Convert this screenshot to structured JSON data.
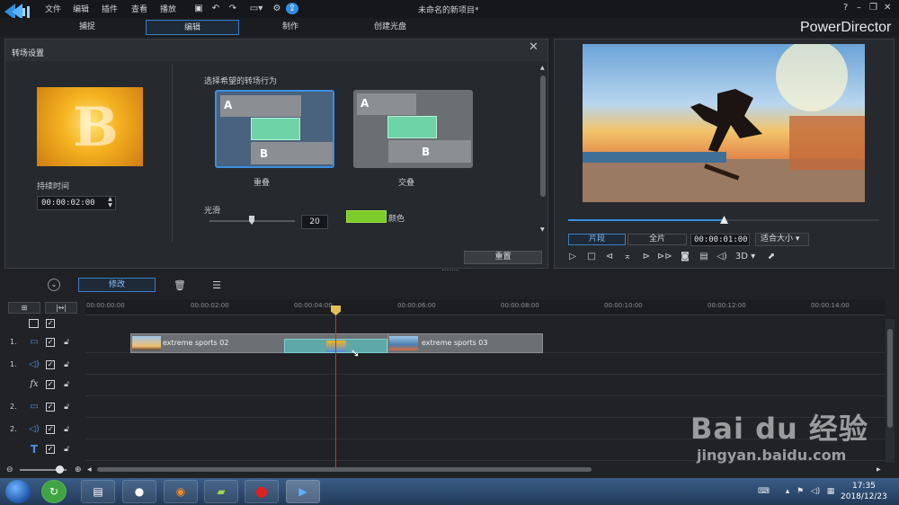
{
  "app": {
    "title": "未命名的新项目*",
    "brand": "PowerDirector"
  },
  "menu": [
    "文件",
    "编辑",
    "插件",
    "查看",
    "播放"
  ],
  "modes": [
    "捕捉",
    "编辑",
    "制作",
    "创建光盘"
  ],
  "transition_panel": {
    "title": "转场设置",
    "duration_label": "持续时间",
    "duration": "00:00:02:00",
    "behavior_label": "选择希望的转场行为",
    "options": [
      {
        "label": "重叠",
        "a": "A",
        "b": "B"
      },
      {
        "label": "交叠",
        "a": "A",
        "b": "B"
      }
    ],
    "smooth_label": "光滑",
    "smooth_value": "20",
    "color_label": "颜色",
    "color_value": "#7ccc2a",
    "reset": "重置",
    "thumb_letter": "B"
  },
  "preview": {
    "clip_btn": "片段",
    "full_btn": "全片",
    "timecode": "00:00:01:00",
    "fit": "适合大小",
    "threed": "3D",
    "progress": 0.5
  },
  "toolbar": {
    "modify": "修改"
  },
  "timeline": {
    "ticks": [
      "00:00:00:00",
      "00:00:02:00",
      "00:00:04:00",
      "00:00:06:00",
      "00:00:08:00",
      "00:00:10:00",
      "00:00:12:00",
      "00:00:14:00"
    ],
    "tracks": [
      {
        "num": "1.",
        "icon": "video"
      },
      {
        "num": "1.",
        "icon": "audio"
      },
      {
        "num": "",
        "icon": "fx"
      },
      {
        "num": "2.",
        "icon": "video"
      },
      {
        "num": "2.",
        "icon": "audio"
      },
      {
        "num": "",
        "icon": "text"
      }
    ],
    "clips": [
      {
        "label": "extreme sports 02"
      },
      {
        "label": "extreme sports 03"
      }
    ]
  },
  "taskbar": {
    "time": "17:35",
    "date": "2018/12/23"
  },
  "watermark": {
    "brand": "Bai du 经验",
    "url": "jingyan.baidu.com"
  }
}
